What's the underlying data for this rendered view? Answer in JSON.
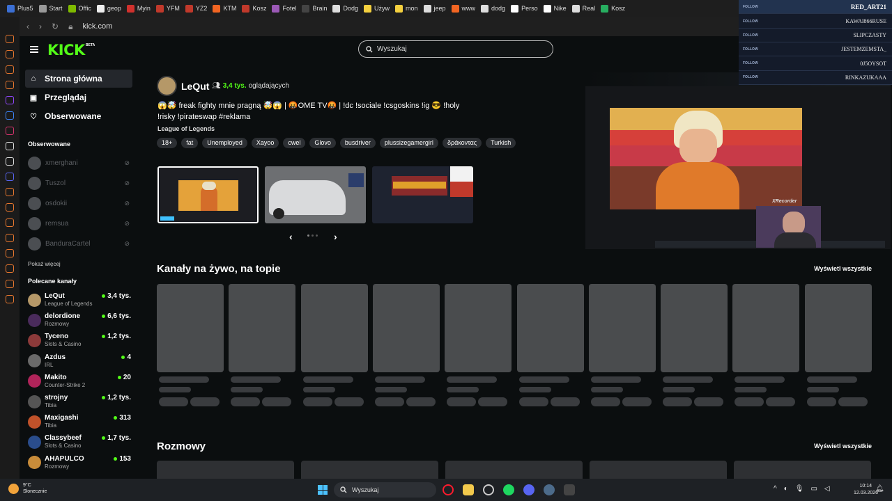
{
  "bookmarks": [
    {
      "label": "Plus5",
      "color": "#3b6fd4"
    },
    {
      "label": "Start",
      "color": "#999999"
    },
    {
      "label": "Offic",
      "color": "#7fba00"
    },
    {
      "label": "geop",
      "color": "#eeeeee"
    },
    {
      "label": "Myin",
      "color": "#d0312d"
    },
    {
      "label": "YFM",
      "color": "#c0392b"
    },
    {
      "label": "YZ2",
      "color": "#c0392b"
    },
    {
      "label": "KTM",
      "color": "#f26522"
    },
    {
      "label": "Kosz",
      "color": "#c0392b"
    },
    {
      "label": "Fotel",
      "color": "#9b59b6"
    },
    {
      "label": "Brain",
      "color": "#444444"
    },
    {
      "label": "Dodg",
      "color": "#dddddd"
    },
    {
      "label": "Używ",
      "color": "#f4d03f"
    },
    {
      "label": "mon",
      "color": "#f4d03f"
    },
    {
      "label": "jeep",
      "color": "#dddddd"
    },
    {
      "label": "www",
      "color": "#f26522"
    },
    {
      "label": "dodg",
      "color": "#dddddd"
    },
    {
      "label": "Perso",
      "color": "#ffffff"
    },
    {
      "label": "Nike",
      "color": "#ffffff"
    },
    {
      "label": "Real",
      "color": "#dddddd"
    },
    {
      "label": "Kosz",
      "color": "#27ae60"
    }
  ],
  "address_bar": {
    "url": "kick.com"
  },
  "header": {
    "logo": "KICK",
    "logo_badge": "BETA",
    "search_placeholder": "Wyszukaj"
  },
  "nav": [
    {
      "label": "Strona główna",
      "icon": "home-icon",
      "active": true
    },
    {
      "label": "Przeglądaj",
      "icon": "browse-icon",
      "active": false
    },
    {
      "label": "Obserwowane",
      "icon": "heart-icon",
      "active": false
    }
  ],
  "following": {
    "title": "Obserwowane",
    "channels": [
      "xmerghani",
      "Tuszol",
      "osdokii",
      "remsua",
      "BanduraCartel"
    ],
    "show_more": "Pokaż więcej"
  },
  "recommended": {
    "title": "Polecane kanały",
    "channels": [
      {
        "name": "LeQut",
        "category": "League of Legends",
        "viewers": "3,4 tys.",
        "color": "#b59868"
      },
      {
        "name": "delordione",
        "category": "Rozmowy",
        "viewers": "6,6 tys.",
        "color": "#4a2b5c"
      },
      {
        "name": "Tyceno",
        "category": "Slots & Casino",
        "viewers": "1,2 tys.",
        "color": "#8c3a3a"
      },
      {
        "name": "Azdus",
        "category": "IRL",
        "viewers": "4",
        "color": "#6a6a6a"
      },
      {
        "name": "Makito",
        "category": "Counter-Strike 2",
        "viewers": "20",
        "color": "#b0245a"
      },
      {
        "name": "strojny",
        "category": "Tibia",
        "viewers": "1,2 tys.",
        "color": "#555555"
      },
      {
        "name": "Maxigashi",
        "category": "Tibia",
        "viewers": "313",
        "color": "#c0522a"
      },
      {
        "name": "Classybeef",
        "category": "Slots & Casino",
        "viewers": "1,7 tys.",
        "color": "#2a4d8c"
      },
      {
        "name": "AHAPULCO",
        "category": "Rozmowy",
        "viewers": "153",
        "color": "#c88c3a"
      }
    ]
  },
  "featured": {
    "name": "LeQut",
    "viewers": "3,4 tys.",
    "viewers_suffix": "oglądających",
    "title": "😱🤯 freak fighty mnie pragną 🤯😱 | 🤬OME TV🤬 | !dc !sociale !csgoskins !ig 😎 !holy !risky !pirateswap #reklama",
    "game": "League of Legends",
    "tags": [
      "18+",
      "fat",
      "Unemployed",
      "Xayoo",
      "cwel",
      "Glovo",
      "busdriver",
      "plussizegamergirl",
      "δράκοντας",
      "Turkish"
    ],
    "carousel_prev": "‹",
    "carousel_next": "›",
    "video_overlay_text": "XRecorder"
  },
  "sections": [
    {
      "title": "Kanały na żywo, na topie",
      "see_all": "Wyświetl wszystkie"
    },
    {
      "title": "Rozmowy",
      "see_all": "Wyświetl wszystkie"
    }
  ],
  "chat_overlay": {
    "follow_label": "FOLLOW",
    "users": [
      "RED_ART21",
      "KAWAI866RUSE",
      "SLIPCZASTY",
      "JESTEMZEMSTA_",
      "0J5OYSOT",
      "RINKAZUKAAA"
    ]
  },
  "taskbar": {
    "temperature": "9°C",
    "weather": "Słonecznie",
    "search_label": "Wyszukaj",
    "time": "10:14",
    "date": "12.03.2026"
  }
}
